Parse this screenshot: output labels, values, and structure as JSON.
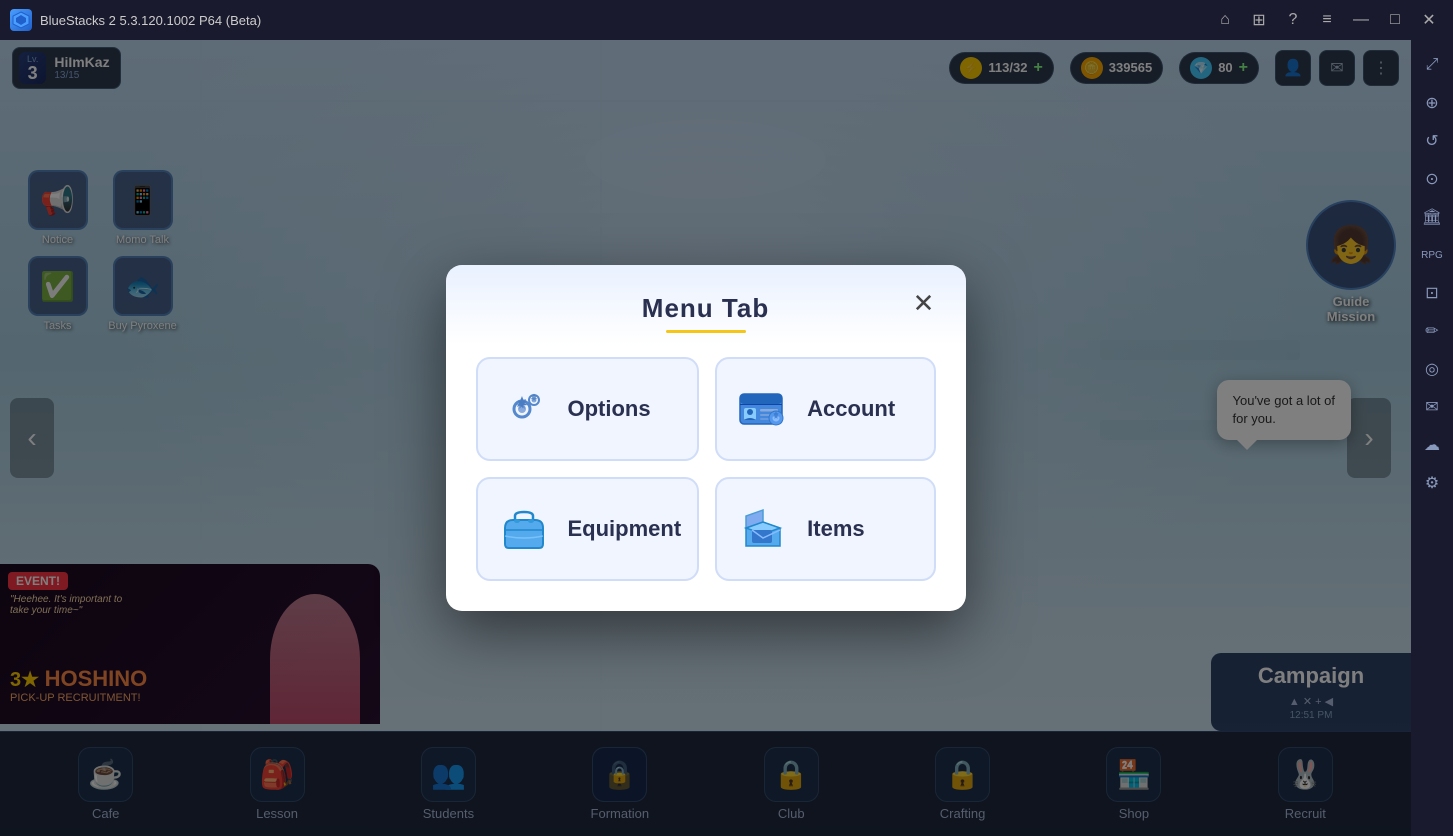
{
  "titlebar": {
    "logo_text": "BS",
    "title": "BlueStacks 2  5.3.120.1002 P64 (Beta)",
    "buttons": [
      "⌂",
      "⊞",
      "?",
      "≡",
      "—",
      "□",
      "✕"
    ]
  },
  "player": {
    "level": "3",
    "lv_label": "Lv.",
    "name": "HiImKaz",
    "exp": "13/15"
  },
  "resources": [
    {
      "id": "energy",
      "icon": "⚡",
      "value": "113/32",
      "has_plus": true
    },
    {
      "id": "coins",
      "icon": "💰",
      "value": "339565",
      "has_plus": false
    },
    {
      "id": "gems",
      "icon": "💎",
      "value": "80",
      "has_plus": true
    }
  ],
  "hud_actions": [
    "👤",
    "✉",
    "⋮⋮⋮"
  ],
  "side_buttons": [
    {
      "id": "notice",
      "icon": "📢",
      "label": "Notice"
    },
    {
      "id": "momo-talk",
      "icon": "📱",
      "label": "Momo Talk"
    },
    {
      "id": "tasks",
      "icon": "✅",
      "label": "Tasks"
    },
    {
      "id": "buy-pyroxene",
      "icon": "🐟",
      "label": "Buy Pyroxene"
    }
  ],
  "nav_arrows": {
    "left": "‹",
    "right": "›"
  },
  "chat_bubble": {
    "text": "You've got a lot of\nfor you."
  },
  "guide_mission": {
    "label": "Guide\nMission"
  },
  "event_banner": {
    "event_label": "EVENT!",
    "quote": "\"Heehee. It's important to\ntake your time~\"",
    "star": "3★",
    "name": "HOSHINO",
    "subtitle": "PICK-UP RECRUITMENT!"
  },
  "campaign_panel": {
    "label": "Campaign"
  },
  "bottom_nav": [
    {
      "id": "cafe",
      "icon": "☕",
      "label": "Cafe"
    },
    {
      "id": "lesson",
      "icon": "🎒",
      "label": "Lesson"
    },
    {
      "id": "students",
      "icon": "👥",
      "label": "Students"
    },
    {
      "id": "formation",
      "icon": "🔒",
      "label": "Formation"
    },
    {
      "id": "club",
      "icon": "🔒",
      "label": "Club"
    },
    {
      "id": "crafting",
      "icon": "🔒",
      "label": "Crafting"
    },
    {
      "id": "shop",
      "icon": "🏪",
      "label": "Shop"
    },
    {
      "id": "recruit",
      "icon": "🐰",
      "label": "Recruit"
    }
  ],
  "time": "12:51 PM",
  "modal": {
    "title": "Menu Tab",
    "close_btn": "✕",
    "items": [
      {
        "id": "options",
        "icon_type": "gear",
        "label": "Options"
      },
      {
        "id": "account",
        "icon_type": "account",
        "label": "Account"
      },
      {
        "id": "equipment",
        "icon_type": "bag",
        "label": "Equipment"
      },
      {
        "id": "items",
        "icon_type": "box",
        "label": "Items"
      }
    ]
  },
  "sidebar_icons": [
    "⤢",
    "⊕",
    "↺",
    "⊙",
    "🏛",
    "RPG",
    "⊡",
    "✏",
    "⊙",
    "✉",
    "☁",
    "⚙"
  ]
}
